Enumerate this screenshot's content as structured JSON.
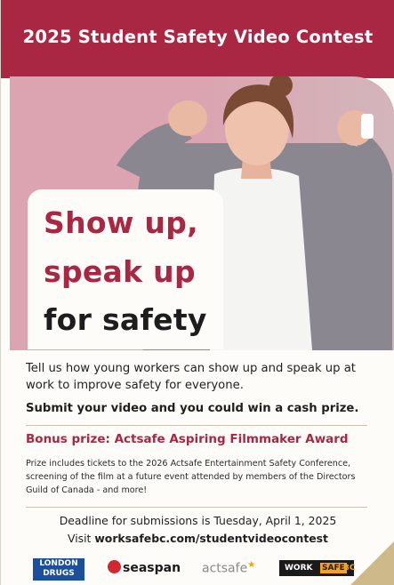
{
  "header": {
    "title": "2025 Student Safety Video Contest"
  },
  "headline": {
    "line1": "Show up,",
    "line2": "speak up",
    "line3": "for safety"
  },
  "body": {
    "intro": "Tell us how young workers can show up and speak up at work to improve safety for everyone.",
    "submit": "Submit your video and you could win a cash prize."
  },
  "bonus": {
    "title": "Bonus prize: Actsafe Aspiring Filmmaker Award",
    "description": "Prize includes tickets to the 2026 Actsafe Entertainment Safety Conference, screening of the film at a future event attended by members of the Directors Guild of Canada - and more!"
  },
  "deadline": {
    "text": "Deadline for submissions is Tuesday, April 1, 2025",
    "visit_prefix": "Visit ",
    "url": "worksafebc.com/studentvideocontest"
  },
  "sponsors": {
    "london_drugs": "LONDON DRUGS",
    "seaspan": "seaspan",
    "actsafe": "actsafe",
    "worksafe_work": "WORK",
    "worksafe_safe": "SAFE",
    "worksafe_bc": "BC"
  },
  "colors": {
    "brand": "#a92743",
    "hero_bg": "#dba4b0",
    "worksafe_orange": "#f7a21b"
  }
}
